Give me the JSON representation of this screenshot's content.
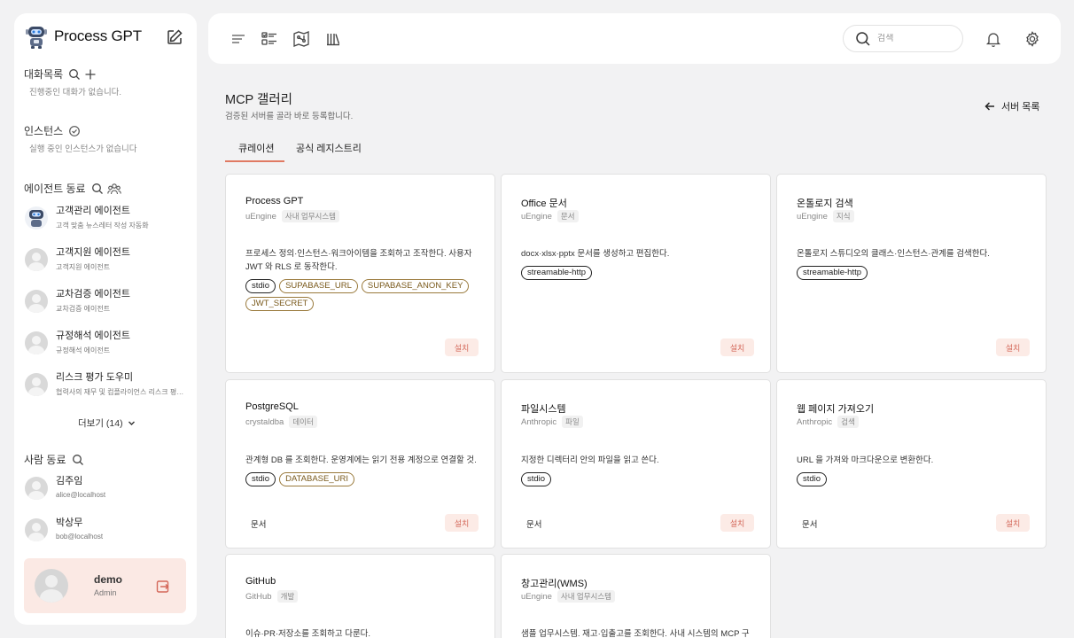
{
  "sidebar": {
    "brand": "Process GPT",
    "conversations": {
      "title": "대화목록",
      "empty": "진행중인 대화가 없습니다."
    },
    "instances": {
      "title": "인스턴스",
      "empty": "실행 중인 인스턴스가 없습니다"
    },
    "agents": {
      "title": "에이전트 동료",
      "items": [
        {
          "name": "고객관리 에이전트",
          "desc": "고객 맞춤 뉴스레터 작성 자동화"
        },
        {
          "name": "고객지원 에이전트",
          "desc": "고객지원 에이전트"
        },
        {
          "name": "교차검증 에이전트",
          "desc": "교차검증 에이전트"
        },
        {
          "name": "규정해석 에이전트",
          "desc": "규정해석 에이전트"
        },
        {
          "name": "리스크 평가 도우미",
          "desc": "협력사의 재무 및 컴플라이언스 리스크 평가 ..."
        }
      ],
      "more": "더보기 (14)"
    },
    "people": {
      "title": "사람 동료",
      "items": [
        {
          "name": "김주임",
          "email": "alice@localhost"
        },
        {
          "name": "박상무",
          "email": "bob@localhost"
        }
      ]
    },
    "user": {
      "name": "demo",
      "role": "Admin"
    }
  },
  "topbar": {
    "search_placeholder": "검색"
  },
  "main": {
    "title": "MCP 갤러리",
    "subtitle": "검증된 서버를 골라 바로 등록합니다.",
    "back": "서버 목록",
    "tabs": [
      "큐레이션",
      "공식 레지스트리"
    ],
    "install": "설치",
    "docs": "문서",
    "cards": [
      {
        "title": "Process GPT",
        "vendor": "uEngine",
        "category": "사내 업무시스템",
        "desc": "프로세스 정의·인스턴스·워크아이템을 조회하고 조작한다. 사용자 JWT 와 RLS 로 동작한다.",
        "chips": [
          "stdio"
        ],
        "env": [
          "SUPABASE_URL",
          "SUPABASE_ANON_KEY",
          "JWT_SECRET"
        ]
      },
      {
        "title": "Office 문서",
        "vendor": "uEngine",
        "category": "문서",
        "desc": "docx·xlsx·pptx 문서를 생성하고 편집한다.",
        "chips": [
          "streamable-http"
        ],
        "env": []
      },
      {
        "title": "온톨로지 검색",
        "vendor": "uEngine",
        "category": "지식",
        "desc": "온톨로지 스튜디오의 클래스·인스턴스·관계를 검색한다.",
        "chips": [
          "streamable-http"
        ],
        "env": []
      },
      {
        "title": "PostgreSQL",
        "vendor": "crystaldba",
        "category": "데이터",
        "desc": "관계형 DB 를 조회한다. 운영계에는 읽기 전용 계정으로 연결할 것.",
        "chips": [
          "stdio"
        ],
        "env": [
          "DATABASE_URI"
        ]
      },
      {
        "title": "파일시스템",
        "vendor": "Anthropic",
        "category": "파일",
        "desc": "지정한 디렉터리 안의 파일을 읽고 쓴다.",
        "chips": [
          "stdio"
        ],
        "env": []
      },
      {
        "title": "웹 페이지 가져오기",
        "vendor": "Anthropic",
        "category": "검색",
        "desc": "URL 을 가져와 마크다운으로 변환한다.",
        "chips": [
          "stdio"
        ],
        "env": []
      },
      {
        "title": "GitHub",
        "vendor": "GitHub",
        "category": "개발",
        "desc": "이슈·PR·저장소를 조회하고 다룬다.",
        "chips": [],
        "env": []
      },
      {
        "title": "창고관리(WMS)",
        "vendor": "uEngine",
        "category": "사내 업무시스템",
        "desc": "샘플 업무시스템. 재고·입출고를 조회한다. 사내 시스템의 MCP 구현",
        "chips": [],
        "env": []
      }
    ]
  }
}
